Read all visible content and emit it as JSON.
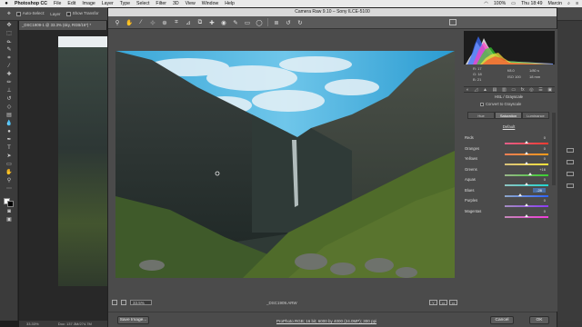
{
  "menubar": {
    "app": "Photoshop CC",
    "items": [
      "File",
      "Edit",
      "Image",
      "Layer",
      "Type",
      "Select",
      "Filter",
      "3D",
      "View",
      "Window",
      "Help"
    ],
    "battery": "100%",
    "clock": "Thu 18:49",
    "user": "Marcin"
  },
  "ps": {
    "options": {
      "auto_select": "Auto-Select:",
      "layer": "Layer",
      "show_transform": "Show Transfor"
    },
    "doc_tab": "_DSC1909-1 @ 33.3% (sky, RGB/16*) *",
    "status_zoom": "33.33%",
    "status_doc": "Doc: 137.3M/274.7M"
  },
  "acr": {
    "title": "Camera Raw 9.10 – Sony ILCE-5100",
    "zoom": "33.5%",
    "filename": "_DSC1909.ARW",
    "workflow": "ProPhoto RGB; 16 bit; 6000 by 4000 (24.0MP); 300 ppi",
    "buttons": {
      "save": "Save Image...",
      "cancel": "Cancel",
      "ok": "OK"
    },
    "view_buttons": [
      "Y",
      "▭",
      "▭"
    ],
    "camera_info": {
      "r": "R: 17",
      "g": "G: 18",
      "b": "B: 21",
      "aperture": "f/8.0",
      "shutter": "1/80 s",
      "iso": "ISO 100",
      "focal": "18 mm"
    },
    "panel": {
      "section_title": "HSL / Grayscale",
      "convert_label": "Convert to Grayscale",
      "tabs": [
        {
          "label": "Hue",
          "active": false
        },
        {
          "label": "Saturation",
          "active": true
        },
        {
          "label": "Luminance",
          "active": false
        }
      ],
      "default_label": "Default",
      "sliders": [
        {
          "label": "Reds",
          "value": "0",
          "level": 0,
          "colors": [
            "#e25f8a",
            "#ff3b2f"
          ]
        },
        {
          "label": "Oranges",
          "value": "0",
          "level": 0,
          "colors": [
            "#f17e55",
            "#ff9b1a"
          ]
        },
        {
          "label": "Yellows",
          "value": "0",
          "level": 0,
          "colors": [
            "#d7c27c",
            "#ffe23a"
          ]
        },
        {
          "label": "Greens",
          "value": "+16",
          "level": 16,
          "colors": [
            "#9ab68a",
            "#39d12f"
          ]
        },
        {
          "label": "Aquas",
          "value": "0",
          "level": 0,
          "colors": [
            "#8fc4c1",
            "#1fd6d0"
          ]
        },
        {
          "label": "Blues",
          "value": "-28",
          "level": -28,
          "colors": [
            "#8ea6c8",
            "#2f64ff"
          ],
          "highlight": true
        },
        {
          "label": "Purples",
          "value": "0",
          "level": 0,
          "colors": [
            "#a48dc0",
            "#8a3cf5"
          ]
        },
        {
          "label": "Magentas",
          "value": "0",
          "level": 0,
          "colors": [
            "#c488b7",
            "#f03bd9"
          ]
        }
      ]
    }
  },
  "colors": {
    "highlight": "#4a6fa5"
  }
}
